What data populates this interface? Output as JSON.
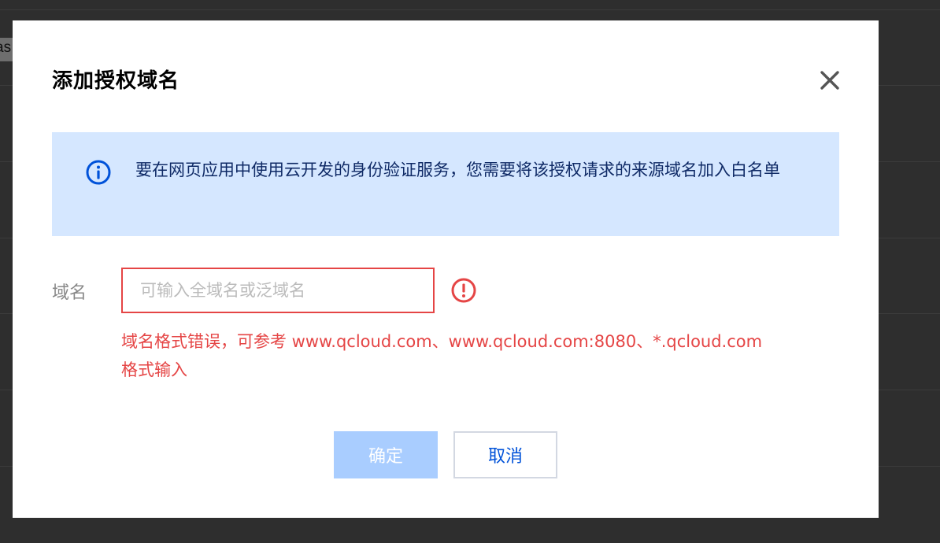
{
  "background": {
    "fragment_text": "as"
  },
  "dialog": {
    "title": "添加授权域名",
    "close_icon": "close-icon",
    "info": {
      "icon": "info-icon",
      "text": "要在网页应用中使用云开发的身份验证服务，您需要将该授权请求的来源域名加入白名单"
    },
    "form": {
      "domain_label": "域名",
      "domain_value": "",
      "domain_placeholder": "可输入全域名或泛域名",
      "error_icon": "error-icon",
      "error_message": "域名格式错误，可参考 www.qcloud.com、www.qcloud.com:8080、*.qcloud.com 格式输入"
    },
    "buttons": {
      "confirm_label": "确定",
      "cancel_label": "取消"
    }
  },
  "colors": {
    "primary": "#0052d9",
    "info_bg": "#d5e7ff",
    "error": "#e54545",
    "confirm_disabled_bg": "#a9cdff"
  }
}
